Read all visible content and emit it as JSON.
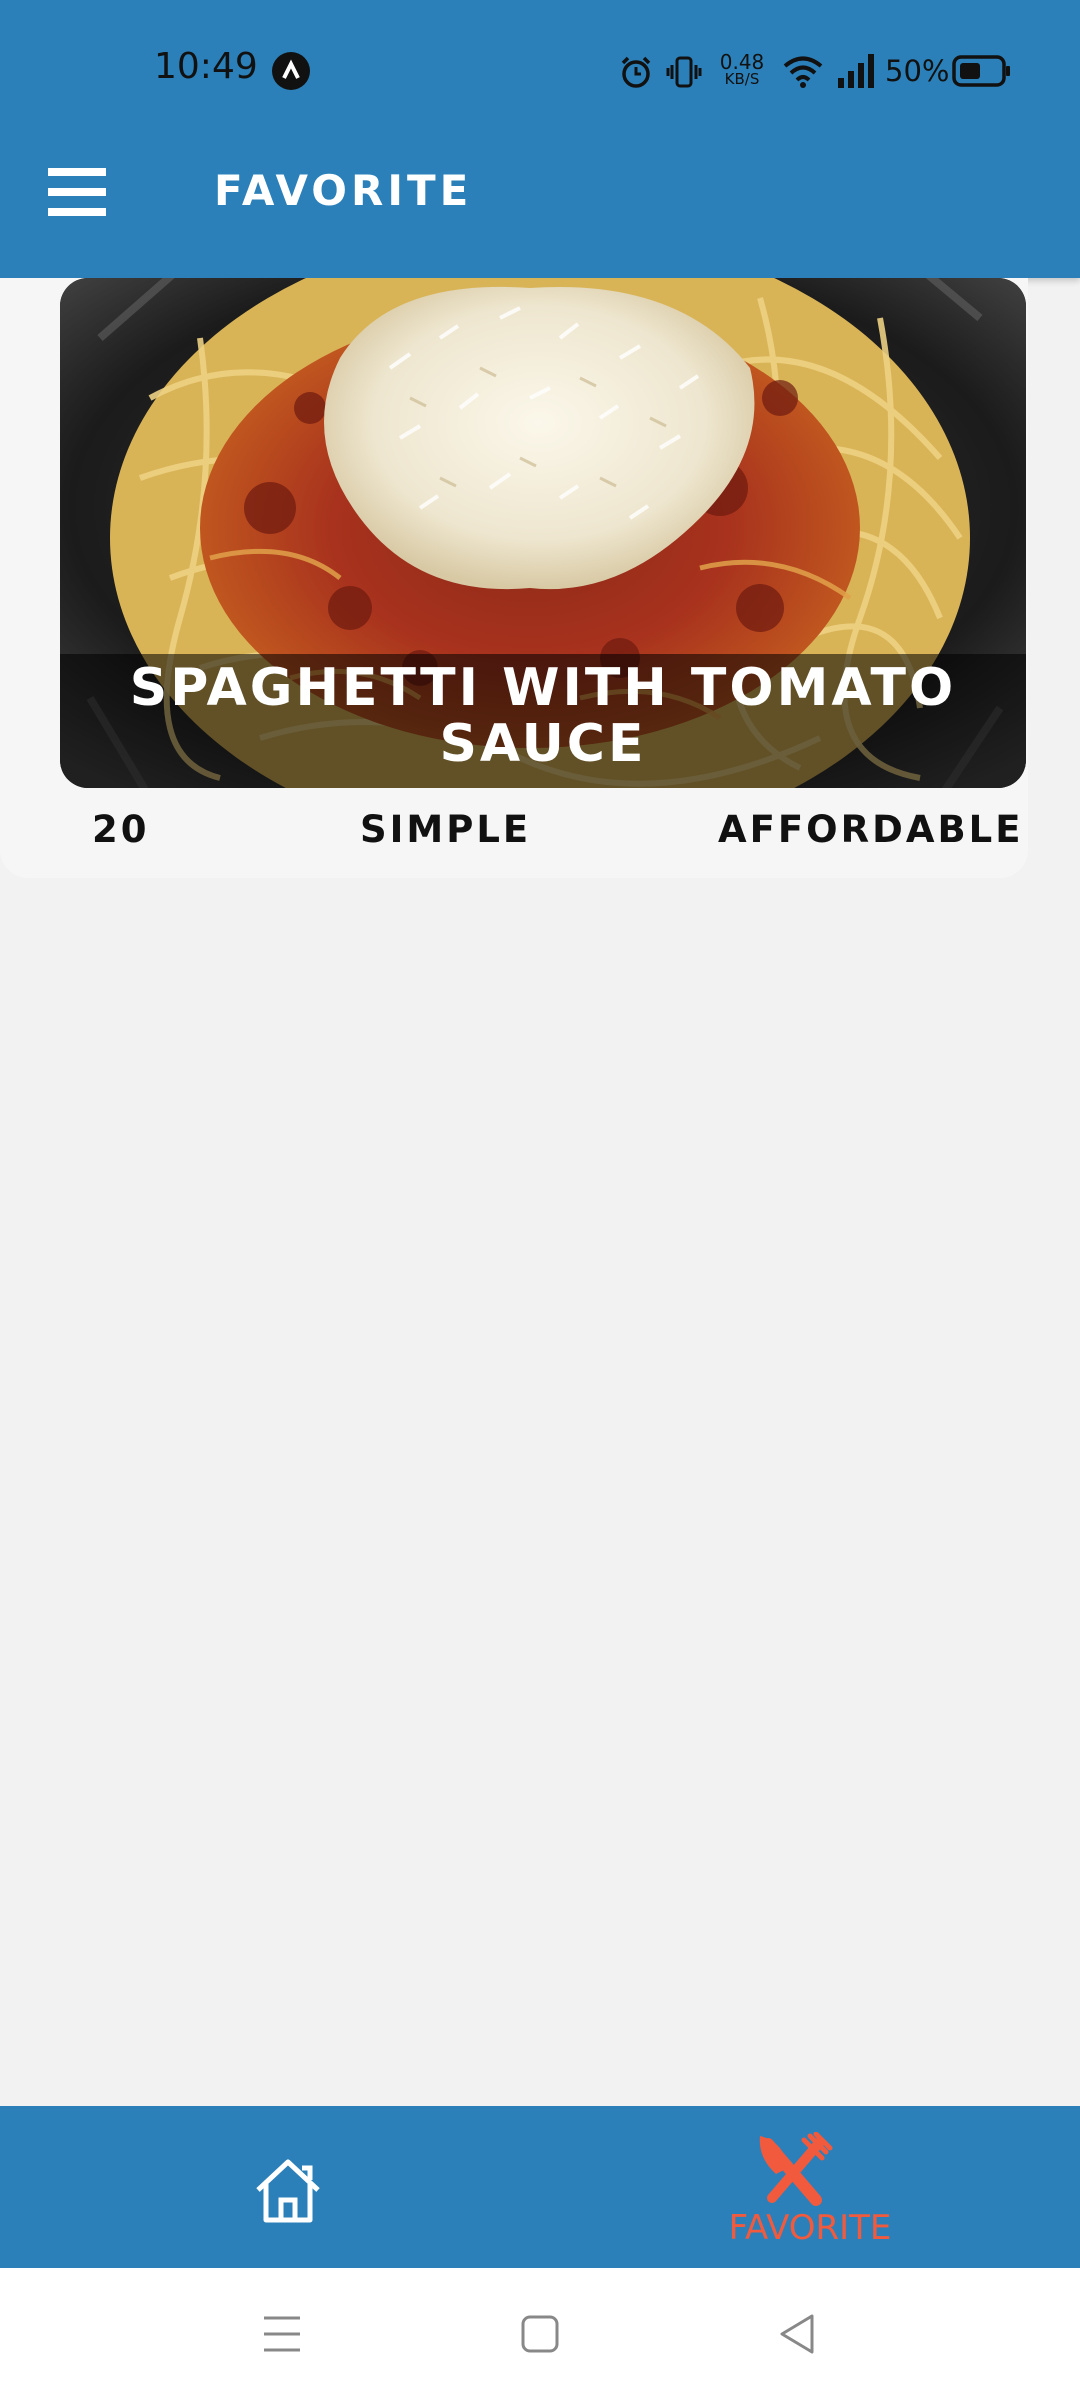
{
  "status_bar": {
    "time": "10:49",
    "net_speed_value": "0.48",
    "net_speed_unit": "KB/S",
    "battery_percent": "50%",
    "icons": [
      "app-notification-icon",
      "alarm-icon",
      "vibrate-icon",
      "wifi-icon",
      "signal-icon",
      "battery-icon"
    ]
  },
  "app_bar": {
    "title": "FAVORITE",
    "menu_icon": "hamburger-menu-icon",
    "color": "#2b80b9"
  },
  "meals": [
    {
      "title": "SPAGHETTI WITH TOMATO SAUCE",
      "duration": "20",
      "complexity": "SIMPLE",
      "affordability": "AFFORDABLE"
    }
  ],
  "tab_bar": {
    "tabs": [
      {
        "icon": "home-icon",
        "label": ""
      },
      {
        "icon": "fork-knife-icon",
        "label": "FAVORITE",
        "active": true
      }
    ],
    "active_color": "#f15a3d"
  },
  "system_nav": {
    "buttons": [
      "recents-icon",
      "home-square-icon",
      "back-triangle-icon"
    ]
  }
}
